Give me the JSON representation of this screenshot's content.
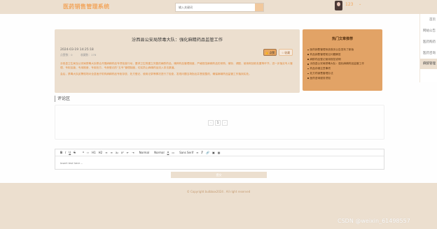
{
  "header": {
    "logo": "医药销售管理系统",
    "search_placeholder": "输入关键词",
    "user_name": "123",
    "user_caret": "⌄"
  },
  "rightnav": [
    "首页",
    "网站公告",
    "医药购药",
    "医药咨询",
    "麻醉管理"
  ],
  "article": {
    "title": "汾西县公安局禁毒大队：强化麻精药品监管工作",
    "date": "2024-03-19 14:25:18",
    "stats": [
      "点赞数：0",
      "收藏数：176"
    ],
    "like_label": "点赞",
    "collect_label": "收藏",
    "paragraphs": [
      "汾西县卫生局及公安局禁毒大队联合开展麻精药品专项检查行动，要求卫生院建立完善的麻醉药品、精神药品管理制度，严格规范麻精药品的采购、储存、调配、使用和回收处置等环节，进一步落实专人管理、专柜加锁、专用账册、专用处方、专册登记的“五专”管理制度，切实防止麻精药品流入非法渠道。",
      "会后，禁毒大队民警现场对全县医疗机构麻精药品专柜存放、处方登记、使用记录等情况进行了检查，发现问题当场指出并督促整改，确保麻精药品监管工作落到实处。"
    ]
  },
  "hot": {
    "title": "热门文章推荐",
    "items": [
      "医药销售管理系统首页公告发布了新版",
      "药品销售管理常见问题解答",
      "麻醉药品登记使用规范说明",
      "汾西县公安局禁毒大队：强化麻精药品监管工作",
      "药品存储注意事项",
      "处方药销售管理办法",
      "医药咨询服务须知"
    ]
  },
  "comments": {
    "heading": "评论区",
    "pager": {
      "prev": "‹",
      "current": "1",
      "next": "›"
    }
  },
  "editor": {
    "toolbar": [
      "B",
      "I",
      "U",
      "S",
      "❝",
      "‹›",
      "H1",
      "H2",
      "≡",
      "≡",
      "x₂",
      "x²",
      "⇤",
      "⇥",
      "Normal",
      "Normal",
      "A",
      "▭",
      "Sans Serif",
      "≡",
      "T̸",
      "🔗",
      "▣",
      "▦"
    ],
    "placeholder": "Insert text here ..."
  },
  "submit_label": "提交",
  "footer": {
    "copyright": "© Copyright bulbbox2024 . All right reserved"
  },
  "watermark": "CSDN @weixin_61498557"
}
